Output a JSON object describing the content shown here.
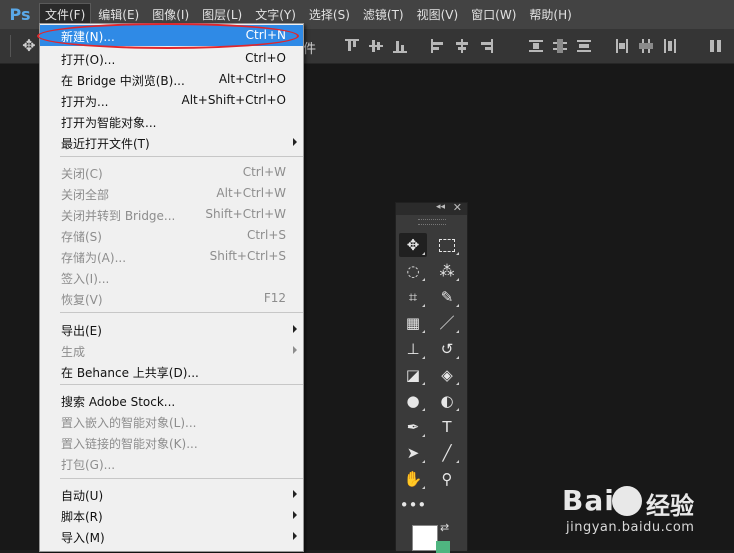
{
  "app": {
    "logo": "Ps"
  },
  "menubar": {
    "items": [
      {
        "label": "文件(F)"
      },
      {
        "label": "编辑(E)"
      },
      {
        "label": "图像(I)"
      },
      {
        "label": "图层(L)"
      },
      {
        "label": "文字(Y)"
      },
      {
        "label": "选择(S)"
      },
      {
        "label": "滤镜(T)"
      },
      {
        "label": "视图(V)"
      },
      {
        "label": "窗口(W)"
      },
      {
        "label": "帮助(H)"
      }
    ]
  },
  "optionsbar": {
    "partial_text": "件"
  },
  "file_menu": {
    "items": [
      {
        "label": "新建(N)...",
        "shortcut": "Ctrl+N"
      },
      {
        "label": "打开(O)...",
        "shortcut": "Ctrl+O"
      },
      {
        "label": "在 Bridge 中浏览(B)...",
        "shortcut": "Alt+Ctrl+O"
      },
      {
        "label": "打开为...",
        "shortcut": "Alt+Shift+Ctrl+O"
      },
      {
        "label": "打开为智能对象...",
        "shortcut": ""
      },
      {
        "label": "最近打开文件(T)",
        "shortcut": ""
      },
      {
        "label": "关闭(C)",
        "shortcut": "Ctrl+W"
      },
      {
        "label": "关闭全部",
        "shortcut": "Alt+Ctrl+W"
      },
      {
        "label": "关闭并转到 Bridge...",
        "shortcut": "Shift+Ctrl+W"
      },
      {
        "label": "存储(S)",
        "shortcut": "Ctrl+S"
      },
      {
        "label": "存储为(A)...",
        "shortcut": "Shift+Ctrl+S"
      },
      {
        "label": "签入(I)...",
        "shortcut": ""
      },
      {
        "label": "恢复(V)",
        "shortcut": "F12"
      },
      {
        "label": "导出(E)",
        "shortcut": ""
      },
      {
        "label": "生成",
        "shortcut": ""
      },
      {
        "label": "在 Behance 上共享(D)...",
        "shortcut": ""
      },
      {
        "label": "搜索 Adobe Stock...",
        "shortcut": ""
      },
      {
        "label": "置入嵌入的智能对象(L)...",
        "shortcut": ""
      },
      {
        "label": "置入链接的智能对象(K)...",
        "shortcut": ""
      },
      {
        "label": "打包(G)...",
        "shortcut": ""
      },
      {
        "label": "自动(U)",
        "shortcut": ""
      },
      {
        "label": "脚本(R)",
        "shortcut": ""
      },
      {
        "label": "导入(M)",
        "shortcut": ""
      }
    ]
  },
  "toolpanel": {
    "text_tool_glyph": "T"
  },
  "colors": {
    "foreground": "#ffffff",
    "background": "#4fb580",
    "highlight": "#2f8ae6",
    "annotation": "#e0262c"
  },
  "watermark": {
    "logo": "Bai",
    "logo_suffix": "经验",
    "url": "jingyan.baidu.com"
  }
}
